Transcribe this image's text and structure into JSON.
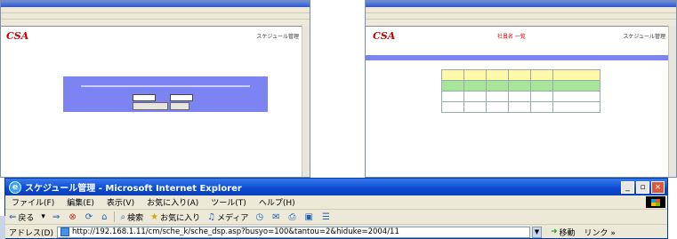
{
  "back_left": {
    "logo": "CSA",
    "header": "スケジュール管理"
  },
  "back_right": {
    "logo": "CSA",
    "header_red": "社員名 一覧",
    "header": "スケジュール管理"
  },
  "front": {
    "title": "スケジュール管理 - Microsoft Internet Explorer",
    "menu": [
      "ファイル(F)",
      "編集(E)",
      "表示(V)",
      "お気に入り(A)",
      "ツール(T)",
      "ヘルプ(H)"
    ],
    "toolbar": {
      "back": "戻る",
      "search": "検索",
      "favorites": "お気に入り",
      "media": "メディア"
    },
    "address_label": "アドレス(D)",
    "url": "http://192.168.1.11/cm/sche_k/sche_dsp.asp?busyo=100&tantou=2&hiduke=2004/11",
    "go": "移動",
    "links": "リンク »"
  },
  "colors": {
    "title_blue": "#0a49d2",
    "panel_blue": "#7c83f2",
    "logo_red": "#c00000"
  }
}
